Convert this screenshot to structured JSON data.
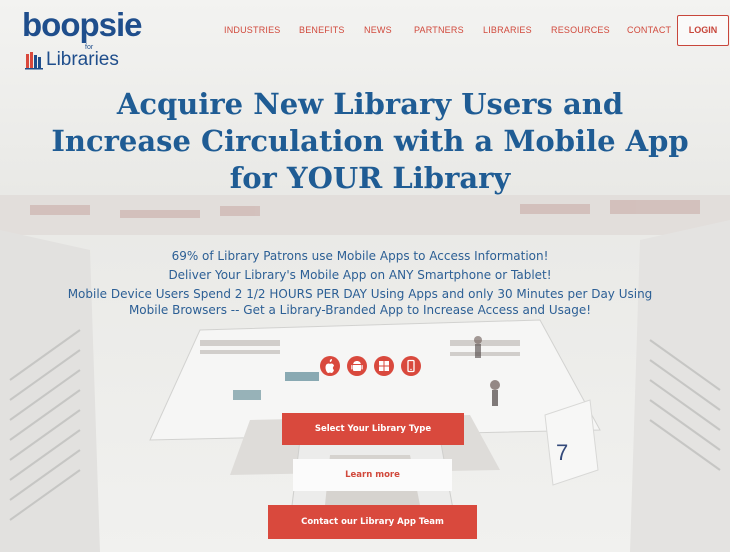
{
  "brand": {
    "logo_main": "boopsie",
    "logo_for": "for",
    "logo_sub": "Libraries"
  },
  "nav": {
    "items": [
      {
        "label": "INDUSTRIES"
      },
      {
        "label": "BENEFITS"
      },
      {
        "label": "NEWS"
      },
      {
        "label": "PARTNERS"
      },
      {
        "label": "LIBRARIES"
      },
      {
        "label": "RESOURCES"
      },
      {
        "label": "CONTACT"
      }
    ],
    "login_label": "LOGIN"
  },
  "hero": {
    "headline_line1": "Acquire New Library Users and",
    "headline_line2": "Increase Circulation with a Mobile App",
    "headline_line3": "for YOUR Library",
    "tagline1": "69% of Library Patrons use Mobile Apps to Access Information!",
    "tagline2": "Deliver Your Library's Mobile App on ANY Smartphone or Tablet!",
    "tagline3": "Mobile Device Users Spend 2 1/2 HOURS PER DAY Using Apps and only 30 Minutes per Day Using",
    "tagline4": "Mobile Browsers -- Get a Library-Branded App to Increase Access and Usage!"
  },
  "platforms": [
    {
      "name": "apple-icon",
      "glyph": ""
    },
    {
      "name": "android-icon",
      "glyph": "◉"
    },
    {
      "name": "windows-icon",
      "glyph": "⊞"
    },
    {
      "name": "mobile-device-icon",
      "glyph": "▯"
    }
  ],
  "actions": {
    "select_type_label": "Select Your Library Type",
    "learn_more_label": "Learn more",
    "contact_team_label": "Contact our Library App Team"
  },
  "colors": {
    "brand_blue": "#1f4e8c",
    "accent_red": "#d9493d",
    "headline_blue": "#1f5c94"
  }
}
